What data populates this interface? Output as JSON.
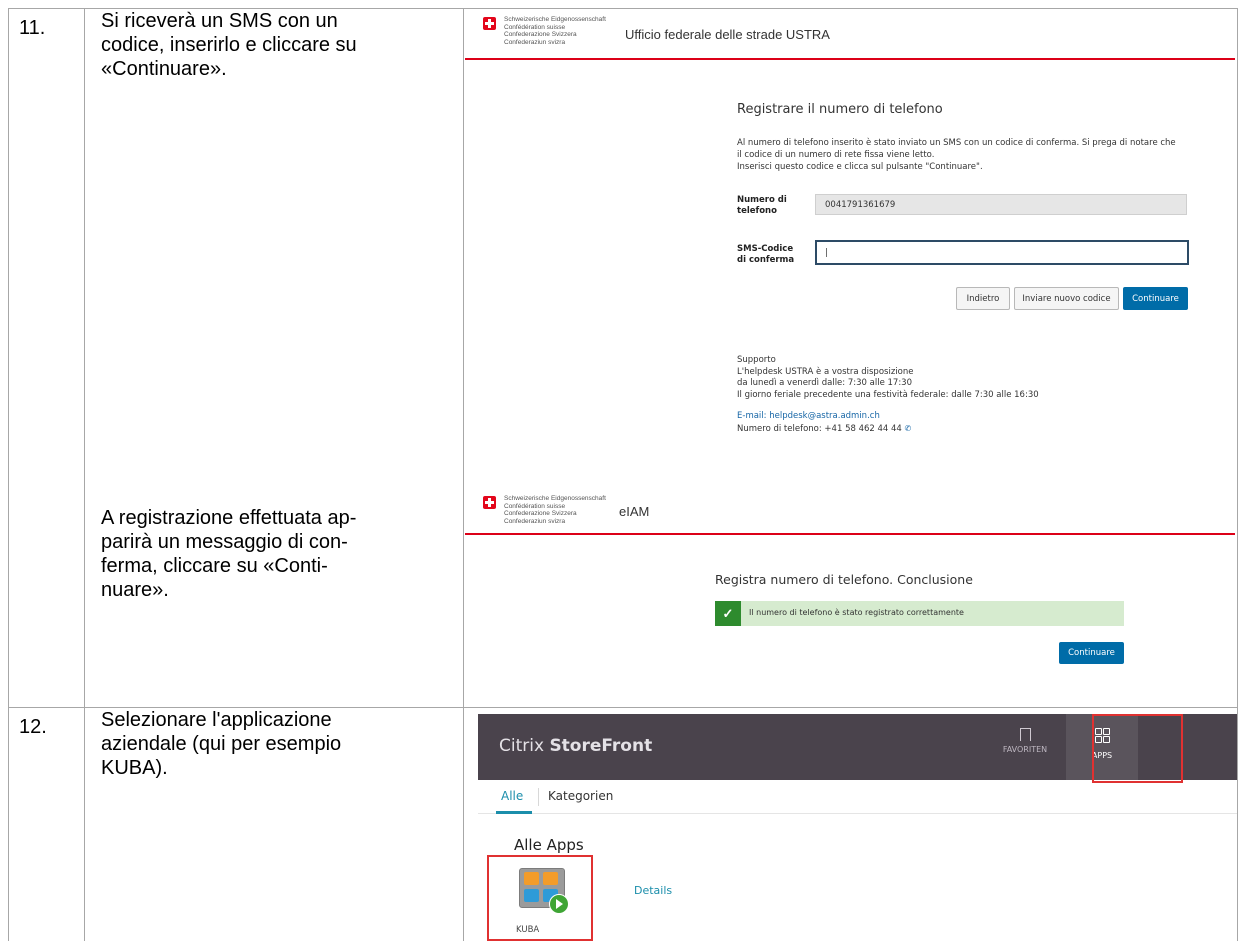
{
  "rows": [
    {
      "number": "11.",
      "instruction_a": "Si riceverà un SMS con un\ncodice, inserirlo e cliccare su\n«Continuare».",
      "instruction_b": "A registrazione effettuata ap-\nparirà un messaggio di con-\nferma, cliccare su «Conti-\nnuare»."
    },
    {
      "number": "12.",
      "instruction": "Selezionare l'applicazione\naziendale (qui per esempio\nKUBA)."
    }
  ],
  "screen1": {
    "fed_lines": [
      "Schweizerische Eidgenossenschaft",
      "Confédération suisse",
      "Confederazione Svizzera",
      "Confederaziun svizra"
    ],
    "header_title": "Ufficio federale delle strade USTRA",
    "page_title": "Registrare il numero di telefono",
    "intro_line1": "Al numero di telefono inserito è stato inviato un SMS con un codice di conferma. Si prega di notare che",
    "intro_line2": "il codice di un numero di rete fissa viene letto.",
    "intro_line3": "Inserisci questo codice e clicca sul pulsante \"Continuare\".",
    "phone_label": "Numero di telefono",
    "phone_value": "0041791361679",
    "sms_label": "SMS-Codice di conferma",
    "sms_value": "|",
    "btn_back": "Indietro",
    "btn_resend": "Inviare nuovo codice",
    "btn_continue": "Continuare",
    "support_title": "Supporto",
    "support_line1": "L'helpdesk USTRA è a vostra disposizione",
    "support_line2": "da lunedì a venerdì dalle: 7:30 alle 17:30",
    "support_line3": "Il giorno feriale precedente una festività federale: dalle 7:30 alle 16:30",
    "email": "E-mail: helpdesk@astra.admin.ch",
    "phone_support": "Numero di telefono: +41 58 462 44 44"
  },
  "screen2": {
    "header_title": "eIAM",
    "page_title": "Registra numero di telefono. Conclusione",
    "success_msg": "Il numero di telefono è stato registrato correttamente",
    "btn_continue": "Continuare"
  },
  "screen3": {
    "brand_prefix": "Citrix ",
    "brand_bold": "StoreFront",
    "nav_favorites": "FAVORITEN",
    "nav_apps": "APPS",
    "tab_all": "Alle",
    "tab_categories": "Kategorien",
    "section_title": "Alle Apps",
    "app_name": "KUBA",
    "details_link": "Details"
  },
  "colors": {
    "swiss_red": "#dc0018",
    "primary_blue": "#006ca8",
    "success_green": "#2e8b2e",
    "success_bg": "#d6ebcf",
    "citrix_bar": "#4a434c",
    "highlight_box": "#e03131",
    "teal": "#1b8eab"
  }
}
